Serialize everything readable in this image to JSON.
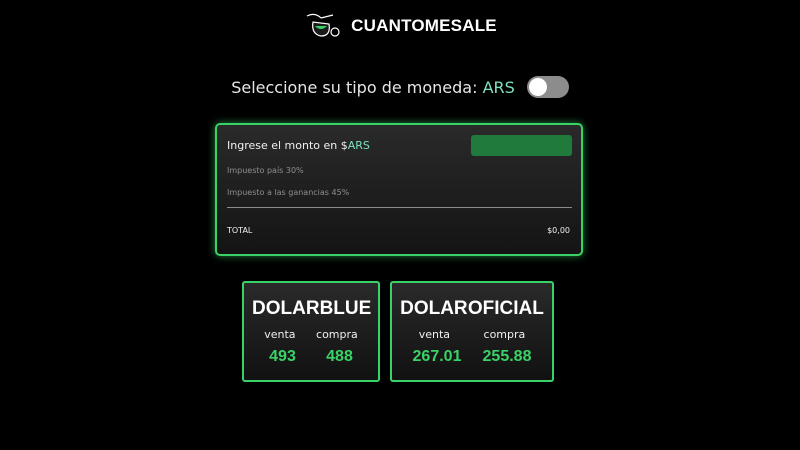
{
  "header": {
    "brand": "CUANTOMESALE",
    "logo_icon": "mate-gourd-icon"
  },
  "currency": {
    "label": "Seleccione su tipo de moneda:",
    "code": "ARS",
    "toggle_on": false
  },
  "calculator": {
    "label_prefix": "Ingrese el monto en $",
    "label_currency": "ARS",
    "input_value": "",
    "tax_pais": "Impuesto país 30%",
    "tax_ganancias": "Impuesto a las ganancias 45%",
    "total_label": "TOTAL",
    "total_value": "$0,00"
  },
  "rates": {
    "blue": {
      "title_1": "DOLAR",
      "title_2": "BLUE",
      "venta_label": "venta",
      "compra_label": "compra",
      "venta": "493",
      "compra": "488"
    },
    "oficial": {
      "title_1": "DOLAR",
      "title_2": "OFICIAL",
      "venta_label": "venta",
      "compra_label": "compra",
      "venta": "267.01",
      "compra": "255.88"
    }
  },
  "colors": {
    "accent_green": "#39d267",
    "input_green": "#1f7a3c",
    "currency_teal": "#7fe0c0",
    "background": "#000000"
  }
}
